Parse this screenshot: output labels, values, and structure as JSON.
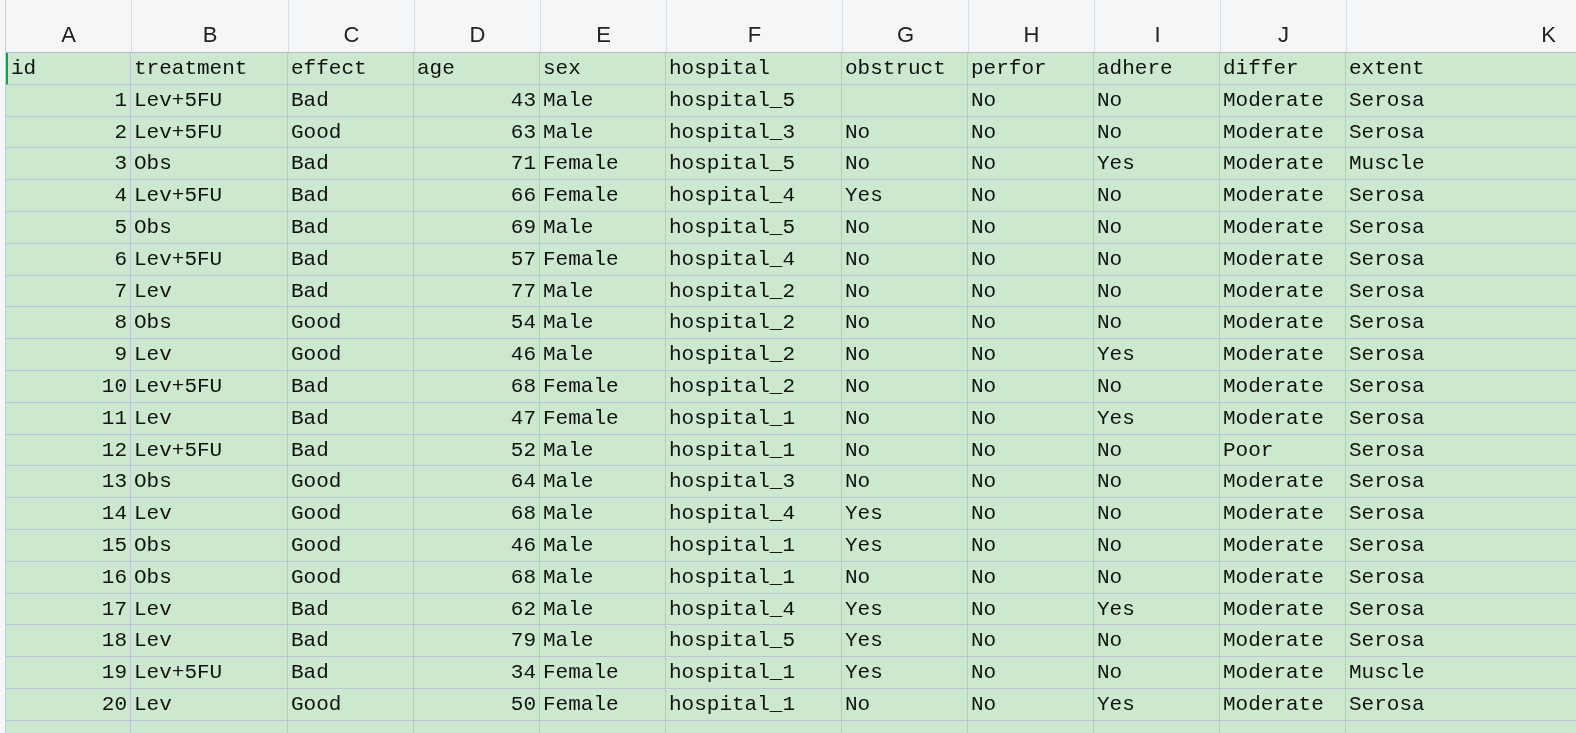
{
  "columns": [
    {
      "letter": "A",
      "kind": "number"
    },
    {
      "letter": "B",
      "kind": "text"
    },
    {
      "letter": "C",
      "kind": "text"
    },
    {
      "letter": "D",
      "kind": "number"
    },
    {
      "letter": "E",
      "kind": "text"
    },
    {
      "letter": "F",
      "kind": "text"
    },
    {
      "letter": "G",
      "kind": "text"
    },
    {
      "letter": "H",
      "kind": "text"
    },
    {
      "letter": "I",
      "kind": "text"
    },
    {
      "letter": "J",
      "kind": "text"
    },
    {
      "letter": "K",
      "kind": "text"
    }
  ],
  "header_row": [
    "id",
    "treatment",
    "effect",
    "age",
    "sex",
    "hospital",
    "obstruct",
    "perfor",
    "adhere",
    "differ",
    "extent"
  ],
  "rows": [
    [
      "1",
      "Lev+5FU",
      "Bad",
      "43",
      "Male",
      "hospital_5",
      null,
      "No",
      "No",
      "Moderate",
      "Serosa"
    ],
    [
      "2",
      "Lev+5FU",
      "Good",
      "63",
      "Male",
      "hospital_3",
      "No",
      "No",
      "No",
      "Moderate",
      "Serosa"
    ],
    [
      "3",
      "Obs",
      "Bad",
      "71",
      "Female",
      "hospital_5",
      "No",
      "No",
      "Yes",
      "Moderate",
      "Muscle"
    ],
    [
      "4",
      "Lev+5FU",
      "Bad",
      "66",
      "Female",
      "hospital_4",
      "Yes",
      "No",
      "No",
      "Moderate",
      "Serosa"
    ],
    [
      "5",
      "Obs",
      "Bad",
      "69",
      "Male",
      "hospital_5",
      "No",
      "No",
      "No",
      "Moderate",
      "Serosa"
    ],
    [
      "6",
      "Lev+5FU",
      "Bad",
      "57",
      "Female",
      "hospital_4",
      "No",
      "No",
      "No",
      "Moderate",
      "Serosa"
    ],
    [
      "7",
      "Lev",
      "Bad",
      "77",
      "Male",
      "hospital_2",
      "No",
      "No",
      "No",
      "Moderate",
      "Serosa"
    ],
    [
      "8",
      "Obs",
      "Good",
      "54",
      "Male",
      "hospital_2",
      "No",
      "No",
      "No",
      "Moderate",
      "Serosa"
    ],
    [
      "9",
      "Lev",
      "Good",
      "46",
      "Male",
      "hospital_2",
      "No",
      "No",
      "Yes",
      "Moderate",
      "Serosa"
    ],
    [
      "10",
      "Lev+5FU",
      "Bad",
      "68",
      "Female",
      "hospital_2",
      "No",
      "No",
      "No",
      "Moderate",
      "Serosa"
    ],
    [
      "11",
      "Lev",
      "Bad",
      "47",
      "Female",
      "hospital_1",
      "No",
      "No",
      "Yes",
      "Moderate",
      "Serosa"
    ],
    [
      "12",
      "Lev+5FU",
      "Bad",
      "52",
      "Male",
      "hospital_1",
      "No",
      "No",
      "No",
      "Poor",
      "Serosa"
    ],
    [
      "13",
      "Obs",
      "Good",
      "64",
      "Male",
      "hospital_3",
      "No",
      "No",
      "No",
      "Moderate",
      "Serosa"
    ],
    [
      "14",
      "Lev",
      "Good",
      "68",
      "Male",
      "hospital_4",
      "Yes",
      "No",
      "No",
      "Moderate",
      "Serosa"
    ],
    [
      "15",
      "Obs",
      "Good",
      "46",
      "Male",
      "hospital_1",
      "Yes",
      "No",
      "No",
      "Moderate",
      "Serosa"
    ],
    [
      "16",
      "Obs",
      "Good",
      "68",
      "Male",
      "hospital_1",
      "No",
      "No",
      "No",
      "Moderate",
      "Serosa"
    ],
    [
      "17",
      "Lev",
      "Bad",
      "62",
      "Male",
      "hospital_4",
      "Yes",
      "No",
      "Yes",
      "Moderate",
      "Serosa"
    ],
    [
      "18",
      "Lev",
      "Bad",
      "79",
      "Male",
      "hospital_5",
      "Yes",
      "No",
      "No",
      "Moderate",
      "Serosa"
    ],
    [
      "19",
      "Lev+5FU",
      "Bad",
      "34",
      "Female",
      "hospital_1",
      "Yes",
      "No",
      "No",
      "Moderate",
      "Muscle"
    ],
    [
      "20",
      "Lev",
      "Good",
      "50",
      "Female",
      "hospital_1",
      "No",
      "No",
      "Yes",
      "Moderate",
      "Serosa"
    ]
  ]
}
